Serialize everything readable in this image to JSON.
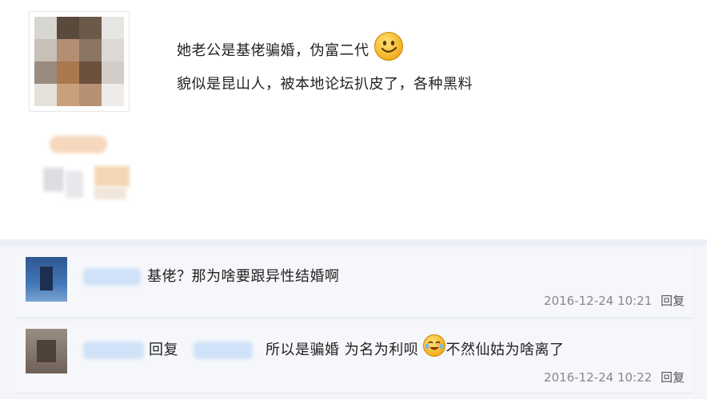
{
  "post": {
    "line1": "她老公是基佬骗婚，伪富二代",
    "line2": "貌似是昆山人，被本地论坛扒皮了，各种黑料",
    "emoji": "smile-emoji"
  },
  "comments": [
    {
      "text": "基佬？那为啥要跟异性结婚啊",
      "time": "2016-12-24 10:21",
      "reply": "回复"
    },
    {
      "prefix": "回复",
      "text_a": "所以是骗婚 为名为利呗",
      "text_b": "不然仙姑为啥离了",
      "time": "2016-12-24 10:22",
      "reply": "回复",
      "emoji": "laugh-cry-emoji"
    }
  ],
  "colors": {
    "background": "#f3f5fa",
    "post_bg": "#ffffff",
    "comment_bg": "#f6f7fb",
    "meta_text": "#888888"
  }
}
